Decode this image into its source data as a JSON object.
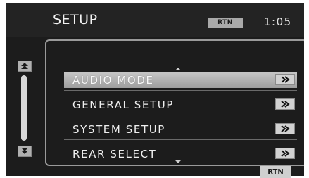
{
  "header": {
    "title": "SETUP",
    "rtn_badge": "RTN",
    "clock": "1:05"
  },
  "menu": {
    "items": [
      {
        "label": "AUDIO MODE",
        "selected": true
      },
      {
        "label": "GENERAL SETUP",
        "selected": false
      },
      {
        "label": "SYSTEM SETUP",
        "selected": false
      },
      {
        "label": "REAR SELECT",
        "selected": false
      }
    ]
  },
  "footer": {
    "rtn_label": "RTN"
  },
  "icons": {
    "scroll_up": "double-chevron-up-icon",
    "scroll_down": "double-chevron-down-icon",
    "item_go": "double-chevron-right-icon"
  },
  "colors": {
    "background": "#1c1c1c",
    "highlight": "#b4b4b4",
    "text": "#eeeeee"
  }
}
